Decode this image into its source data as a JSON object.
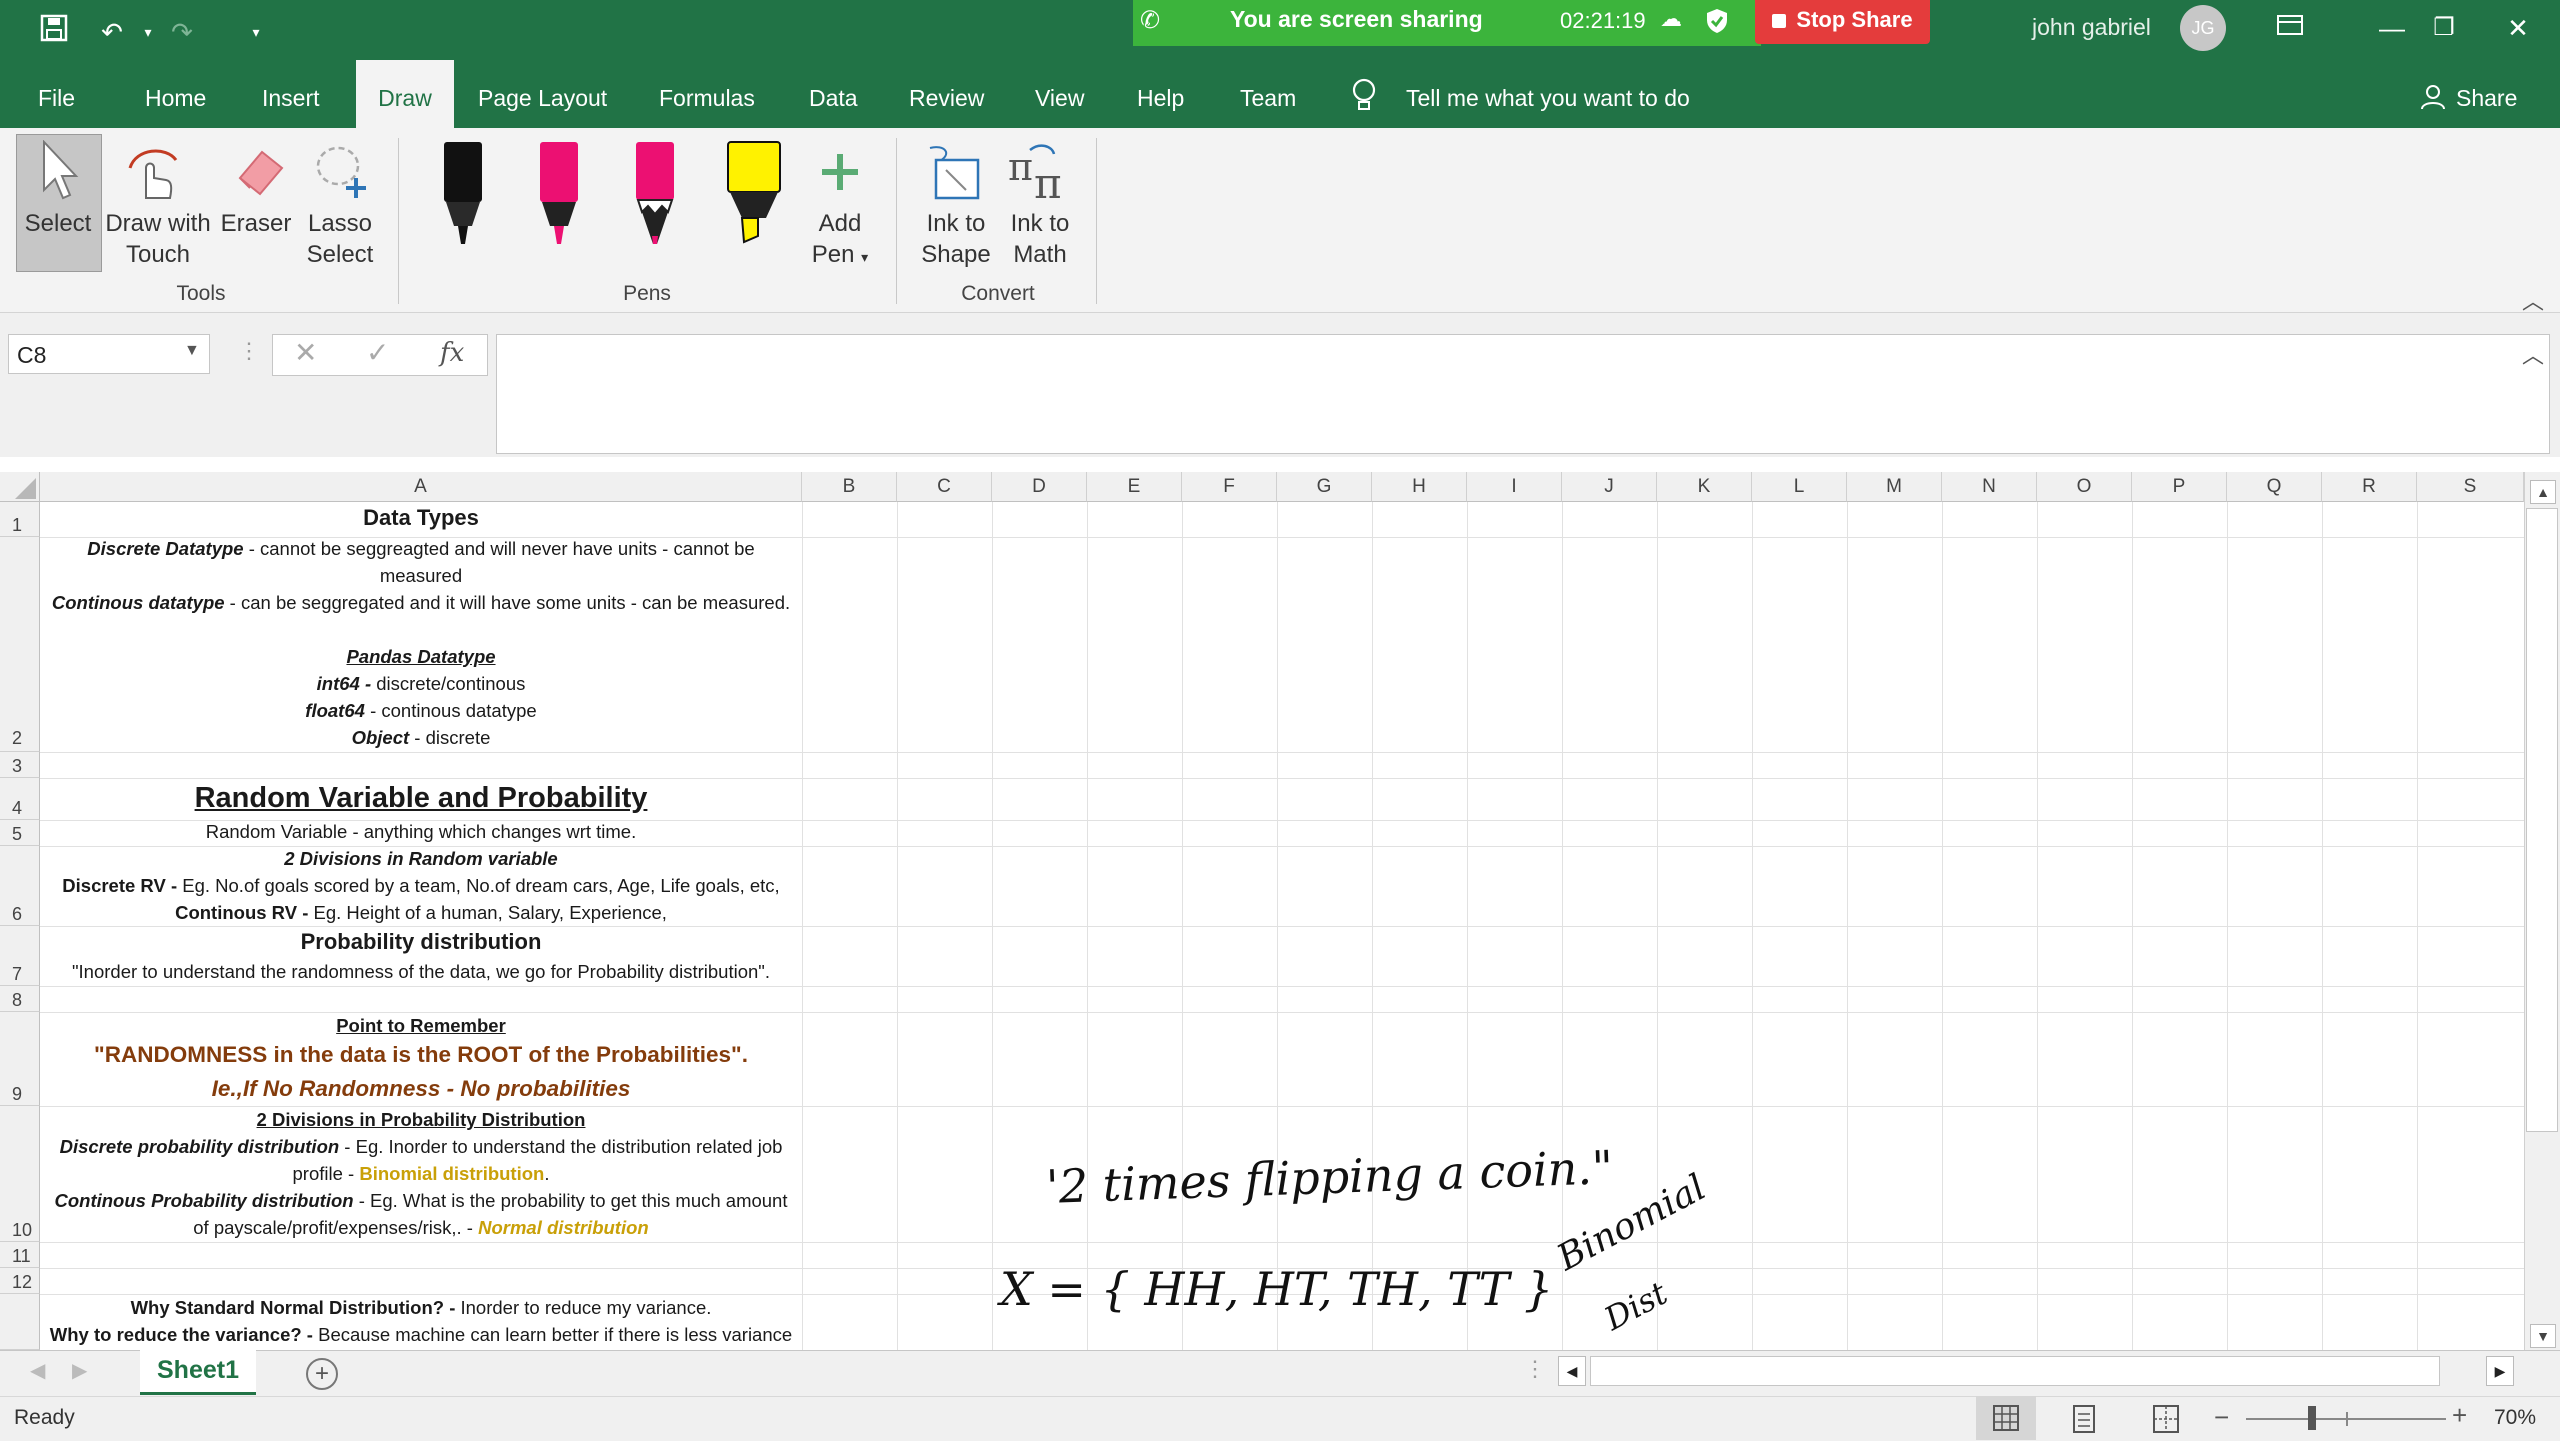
{
  "titlebar": {
    "sharing_text": "You are screen sharing",
    "sharing_time": "02:21:19",
    "stop_share": "Stop Share",
    "user_name": "john gabriel",
    "user_initials": "JG"
  },
  "tabs": [
    "File",
    "Home",
    "Insert",
    "Draw",
    "Page Layout",
    "Formulas",
    "Data",
    "Review",
    "View",
    "Help",
    "Team"
  ],
  "tell_me": "Tell me what you want to do",
  "share_label": "Share",
  "ribbon": {
    "tools": {
      "select": "Select",
      "draw_touch_1": "Draw with",
      "draw_touch_2": "Touch",
      "eraser": "Eraser",
      "lasso_1": "Lasso",
      "lasso_2": "Select",
      "group": "Tools"
    },
    "pens": {
      "add_pen_1": "Add",
      "add_pen_2": "Pen",
      "group": "Pens"
    },
    "convert": {
      "ink_shape_1": "Ink to",
      "ink_shape_2": "Shape",
      "ink_math_1": "Ink to",
      "ink_math_2": "Math",
      "group": "Convert"
    }
  },
  "formula_bar": {
    "name_box": "C8",
    "fx": "fx",
    "value": ""
  },
  "columns": [
    "A",
    "B",
    "C",
    "D",
    "E",
    "F",
    "G",
    "H",
    "I",
    "J",
    "K",
    "L",
    "M",
    "N",
    "O",
    "P",
    "Q",
    "R",
    "S"
  ],
  "rows": [
    "1",
    "2",
    "3",
    "4",
    "5",
    "6",
    "7",
    "8",
    "9",
    "10",
    "11",
    "12"
  ],
  "cells": {
    "r1_title": "Data Types",
    "r2_l1_b": "Discrete Datatype",
    "r2_l1": " - cannot be seggreagted and will never have units - cannot be",
    "r2_l2": "measured",
    "r2_l3_b": "Continous datatype",
    "r2_l3": " - can be seggregated and it will have some units - can be measured.",
    "r2_l4": "Pandas Datatype",
    "r2_l5_b": "int64 -",
    "r2_l5": " discrete/continous",
    "r2_l6_b": "float64",
    "r2_l6": " - continous datatype",
    "r2_l7_b": "Object",
    "r2_l7": " - discrete",
    "r4": "Random Variable and Probability",
    "r5": "Random Variable - anything which changes wrt time.",
    "r6_l1": "2 Divisions in Random variable",
    "r6_l2_b": "Discrete RV -",
    "r6_l2": " Eg. No.of goals scored by a team, No.of dream cars, Age, Life goals, etc,",
    "r6_l3_b": "Continous RV -",
    "r6_l3": " Eg. Height of a human, Salary, Experience,",
    "r7_l1": "Probability distribution",
    "r7_l2": "\"Inorder to understand the randomness of the data, we go for Probability distribution\".",
    "r9_l1": "Point to Remember",
    "r9_l2": "\"RANDOMNESS in the data is the ROOT of the Probabilities\".",
    "r9_l3": "Ie.,If No Randomness - No probabilities",
    "r10_l1": "2 Divisions in Probability Distribution",
    "r10_l2_b": "Discrete probability distribution",
    "r10_l2": " - Eg. Inorder to understand the distribution related job",
    "r10_l3": "profile - ",
    "r10_l3_g": "Binomial distribution",
    "r10_l3_end": ".",
    "r10_l4_b": "Continous Probability distribution",
    "r10_l4": " - Eg. What is the probability to get this much amount",
    "r10_l5": "of payscale/profit/expenses/risk,. - ",
    "r10_l5_g": "Normal distribution",
    "r13_l1_b": "Why Standard Normal Distribution? -",
    "r13_l1": " Inorder to reduce my variance.",
    "r13_l2_b": "Why to reduce the variance? -",
    "r13_l2": " Because machine can learn better if there is less variance"
  },
  "ink": {
    "line1": "'2 times flipping a coin.\"",
    "line2": "X = { HH, HT, TH, TT }",
    "line3a": "Binomial",
    "line3b": "Dist"
  },
  "sheet_tab": "Sheet1",
  "status": {
    "ready": "Ready",
    "zoom": "70%"
  }
}
